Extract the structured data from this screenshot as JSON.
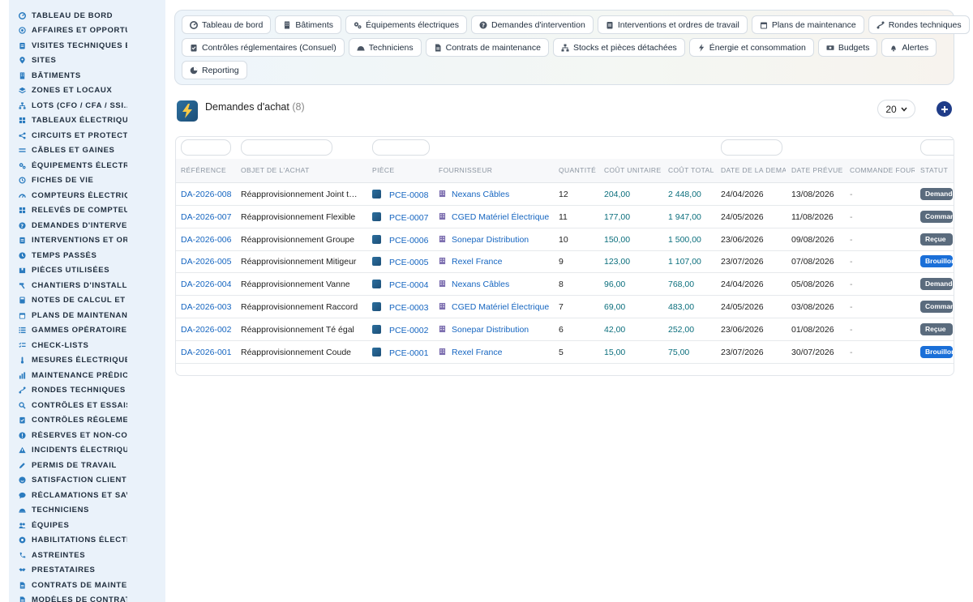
{
  "sidebar": {
    "items": [
      {
        "label": "TABLEAU DE BORD",
        "icon": "dashboard-icon"
      },
      {
        "label": "AFFAIRES ET OPPORTUNITÉS",
        "icon": "target-icon"
      },
      {
        "label": "VISITES TECHNIQUES ET",
        "icon": "clipboard-icon"
      },
      {
        "label": "SITES",
        "icon": "map-pin-icon"
      },
      {
        "label": "BÂTIMENTS",
        "icon": "building-icon"
      },
      {
        "label": "ZONES ET LOCAUX",
        "icon": "layers-icon"
      },
      {
        "label": "LOTS (CFO / CFA / SSI...)",
        "icon": "sitemap-icon"
      },
      {
        "label": "TABLEAUX ÉLECTRIQUES",
        "icon": "grid-icon"
      },
      {
        "label": "CIRCUITS ET PROTECTIONS",
        "icon": "circuit-icon"
      },
      {
        "label": "CÂBLES ET GAINES",
        "icon": "lines-icon"
      },
      {
        "label": "ÉQUIPEMENTS ÉLECTRIQUES",
        "icon": "gears-icon"
      },
      {
        "label": "FICHES DE VIE",
        "icon": "history-icon"
      },
      {
        "label": "COMPTEURS ÉLECTRIQUES",
        "icon": "gauge-icon"
      },
      {
        "label": "RELEVÉS DE COMPTEURS",
        "icon": "grid-icon"
      },
      {
        "label": "DEMANDES D'INTERVENTION",
        "icon": "question-icon"
      },
      {
        "label": "INTERVENTIONS ET ORDRES",
        "icon": "clipboard-icon"
      },
      {
        "label": "TEMPS PASSÉS",
        "icon": "clock-icon"
      },
      {
        "label": "PIÈCES UTILISÉES",
        "icon": "box-icon"
      },
      {
        "label": "CHANTIERS D'INSTALLATION",
        "icon": "hammer-icon"
      },
      {
        "label": "NOTES DE CALCUL ET ÉTUDES",
        "icon": "calculator-icon"
      },
      {
        "label": "PLANS DE MAINTENANCE",
        "icon": "calendar-icon"
      },
      {
        "label": "GAMMES OPÉRATOIRES",
        "icon": "list-icon"
      },
      {
        "label": "CHECK-LISTS",
        "icon": "checklist-icon"
      },
      {
        "label": "MESURES ÉLECTRIQUES",
        "icon": "thermometer-icon"
      },
      {
        "label": "MAINTENANCE PRÉDICTIVE",
        "icon": "chart-icon"
      },
      {
        "label": "RONDES TECHNIQUES",
        "icon": "route-icon"
      },
      {
        "label": "CONTRÔLES ET ESSAIS",
        "icon": "search-icon"
      },
      {
        "label": "CONTRÔLES RÉGLEMENTAIRES",
        "icon": "clipboard-check-icon"
      },
      {
        "label": "RÉSERVES ET NON-CONFORMITÉS",
        "icon": "alert-icon"
      },
      {
        "label": "INCIDENTS ÉLECTRIQUES",
        "icon": "warning-icon"
      },
      {
        "label": "PERMIS DE TRAVAIL",
        "icon": "pen-icon"
      },
      {
        "label": "SATISFACTION CLIENT",
        "icon": "smile-icon"
      },
      {
        "label": "RÉCLAMATIONS ET SAV",
        "icon": "comment-icon"
      },
      {
        "label": "TECHNICIENS",
        "icon": "helmet-icon"
      },
      {
        "label": "ÉQUIPES",
        "icon": "users-icon"
      },
      {
        "label": "HABILITATIONS ÉLECTRIQUES",
        "icon": "certificate-icon"
      },
      {
        "label": "ASTREINTES",
        "icon": "phone-icon"
      },
      {
        "label": "PRESTATAIRES",
        "icon": "handshake-icon"
      },
      {
        "label": "CONTRATS DE MAINTENANCE",
        "icon": "file-icon"
      },
      {
        "label": "MODÈLES DE CONTRATS",
        "icon": "file-icon"
      }
    ]
  },
  "tabs": {
    "row1": [
      {
        "label": "Tableau de bord",
        "icon": "dashboard-icon"
      },
      {
        "label": "Bâtiments",
        "icon": "building-icon"
      },
      {
        "label": "Équipements électriques",
        "icon": "gears-icon"
      },
      {
        "label": "Demandes d'intervention",
        "icon": "question-icon"
      },
      {
        "label": "Interventions et ordres de travail",
        "icon": "clipboard-icon"
      },
      {
        "label": "Plans de maintenance",
        "icon": "calendar-icon"
      },
      {
        "label": "Rondes techniques",
        "icon": "route-icon"
      }
    ],
    "row2": [
      {
        "label": "Contrôles réglementaires (Consuel)",
        "icon": "clipboard-check-icon"
      },
      {
        "label": "Techniciens",
        "icon": "helmet-icon"
      },
      {
        "label": "Contrats de maintenance",
        "icon": "file-icon"
      },
      {
        "label": "Stocks et pièces détachées",
        "icon": "sitemap-icon"
      },
      {
        "label": "Énergie et consommation",
        "icon": "bolt-icon"
      },
      {
        "label": "Budgets",
        "icon": "money-icon"
      },
      {
        "label": "Alertes",
        "icon": "bell-icon"
      }
    ],
    "row3": [
      {
        "label": "Reporting",
        "icon": "pie-icon"
      }
    ]
  },
  "header": {
    "title": "Demandes d'achat",
    "count": "(8)",
    "page_size": "20"
  },
  "columns": [
    "RÉFÉRENCE",
    "OBJET DE L'ACHAT",
    "PIÈCE",
    "FOURNISSEUR",
    "QUANTITÉ",
    "COÛT UNITAIRE",
    "COÛT TOTAL",
    "DATE DE LA DEMANDE",
    "DATE PRÉVUE",
    "COMMANDE FOURNISSEUR",
    "STATUT"
  ],
  "rows": [
    {
      "ref": "DA-2026-008",
      "objet": "Réapprovisionnement Joint torique",
      "piece": "PCE-0008",
      "fournisseur": "Nexans Câbles",
      "qte": "12",
      "pu": "204,00",
      "total": "2 448,00",
      "date_demande": "24/04/2026",
      "date_prevue": "13/08/2026",
      "commande": "-",
      "statut": "Demandée",
      "statut_color": "#5a6b7d"
    },
    {
      "ref": "DA-2026-007",
      "objet": "Réapprovisionnement Flexible",
      "piece": "PCE-0007",
      "fournisseur": "CGED Matériel Électrique",
      "qte": "11",
      "pu": "177,00",
      "total": "1 947,00",
      "date_demande": "24/05/2026",
      "date_prevue": "11/08/2026",
      "commande": "-",
      "statut": "Commandée",
      "statut_color": "#5a6b7d"
    },
    {
      "ref": "DA-2026-006",
      "objet": "Réapprovisionnement Groupe",
      "piece": "PCE-0006",
      "fournisseur": "Sonepar Distribution",
      "qte": "10",
      "pu": "150,00",
      "total": "1 500,00",
      "date_demande": "23/06/2026",
      "date_prevue": "09/08/2026",
      "commande": "-",
      "statut": "Reçue",
      "statut_color": "#5a6b7d"
    },
    {
      "ref": "DA-2026-005",
      "objet": "Réapprovisionnement Mitigeur",
      "piece": "PCE-0005",
      "fournisseur": "Rexel France",
      "qte": "9",
      "pu": "123,00",
      "total": "1 107,00",
      "date_demande": "23/07/2026",
      "date_prevue": "07/08/2026",
      "commande": "-",
      "statut": "Brouillon",
      "statut_color": "#1a6fd8"
    },
    {
      "ref": "DA-2026-004",
      "objet": "Réapprovisionnement Vanne",
      "piece": "PCE-0004",
      "fournisseur": "Nexans Câbles",
      "qte": "8",
      "pu": "96,00",
      "total": "768,00",
      "date_demande": "24/04/2026",
      "date_prevue": "05/08/2026",
      "commande": "-",
      "statut": "Demandée",
      "statut_color": "#5a6b7d"
    },
    {
      "ref": "DA-2026-003",
      "objet": "Réapprovisionnement Raccord",
      "piece": "PCE-0003",
      "fournisseur": "CGED Matériel Électrique",
      "qte": "7",
      "pu": "69,00",
      "total": "483,00",
      "date_demande": "24/05/2026",
      "date_prevue": "03/08/2026",
      "commande": "-",
      "statut": "Commandée",
      "statut_color": "#5a6b7d"
    },
    {
      "ref": "DA-2026-002",
      "objet": "Réapprovisionnement Té égal",
      "piece": "PCE-0002",
      "fournisseur": "Sonepar Distribution",
      "qte": "6",
      "pu": "42,00",
      "total": "252,00",
      "date_demande": "23/06/2026",
      "date_prevue": "01/08/2026",
      "commande": "-",
      "statut": "Reçue",
      "statut_color": "#5a6b7d"
    },
    {
      "ref": "DA-2026-001",
      "objet": "Réapprovisionnement Coude",
      "piece": "PCE-0001",
      "fournisseur": "Rexel France",
      "qte": "5",
      "pu": "15,00",
      "total": "75,00",
      "date_demande": "23/07/2026",
      "date_prevue": "30/07/2026",
      "commande": "-",
      "statut": "Brouillon",
      "statut_color": "#1a6fd8"
    }
  ],
  "colors": {
    "accent": "#1565c0",
    "teal": "#0a6e7c",
    "sidebar_bg": "#eaf2fa",
    "icon": "#2a7bbf"
  }
}
